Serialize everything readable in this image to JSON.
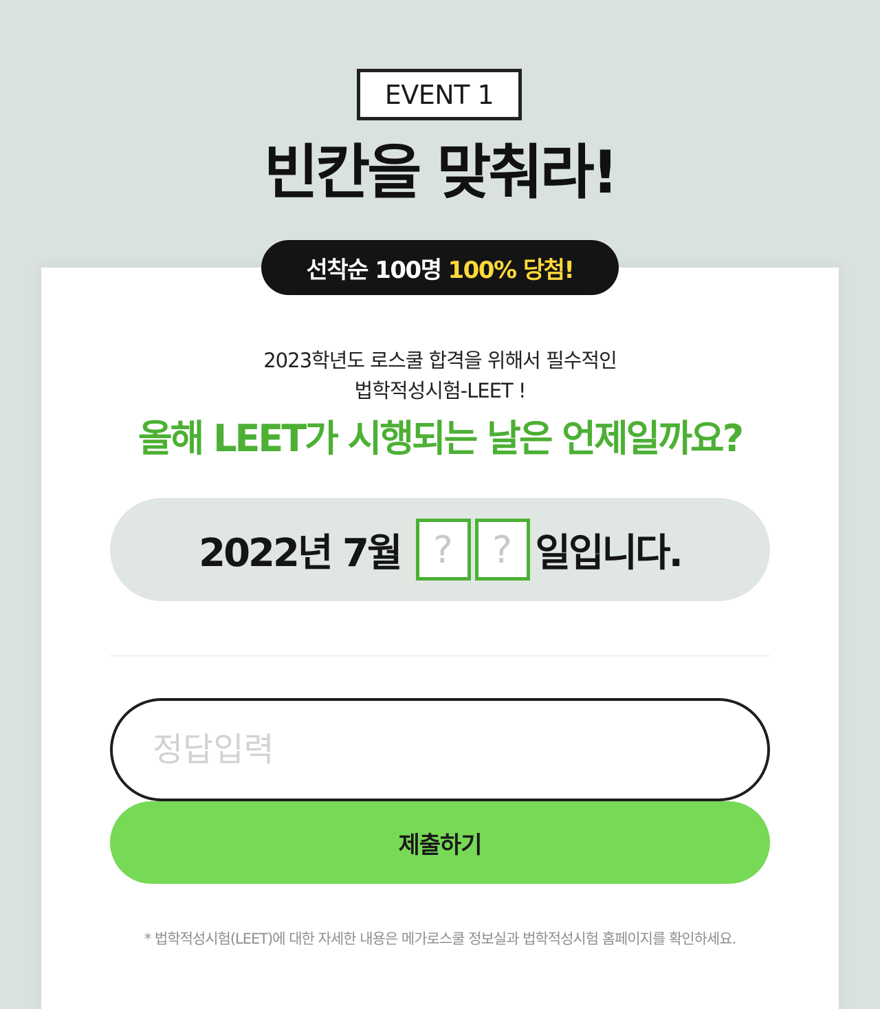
{
  "header": {
    "event_label": "EVENT 1",
    "title": "빈칸을 맞춰라!"
  },
  "promo": {
    "text": "선착순 100명",
    "highlight": "100% 당첨!",
    "highlight_color": "#ffd93a"
  },
  "intro": {
    "line1": "2023학년도 로스쿨 합격을 위해서 필수적인",
    "line2": "법학적성시험-LEET !"
  },
  "question": {
    "text": "올해 LEET가 시행되는 날은 언제일까요?",
    "color": "#4cb034"
  },
  "date_blank": {
    "prefix": "2022년 7월",
    "digits": [
      "?",
      "?"
    ],
    "suffix": "일입니다."
  },
  "answer_form": {
    "placeholder": "정답입력",
    "value": "",
    "submit_label": "제출하기",
    "submit_color": "#78d957"
  },
  "footnote": "* 법학적성시험(LEET)에 대한 자세한 내용은 메가로스쿨 정보실과 법학적성시험 홈페이지를 확인하세요."
}
